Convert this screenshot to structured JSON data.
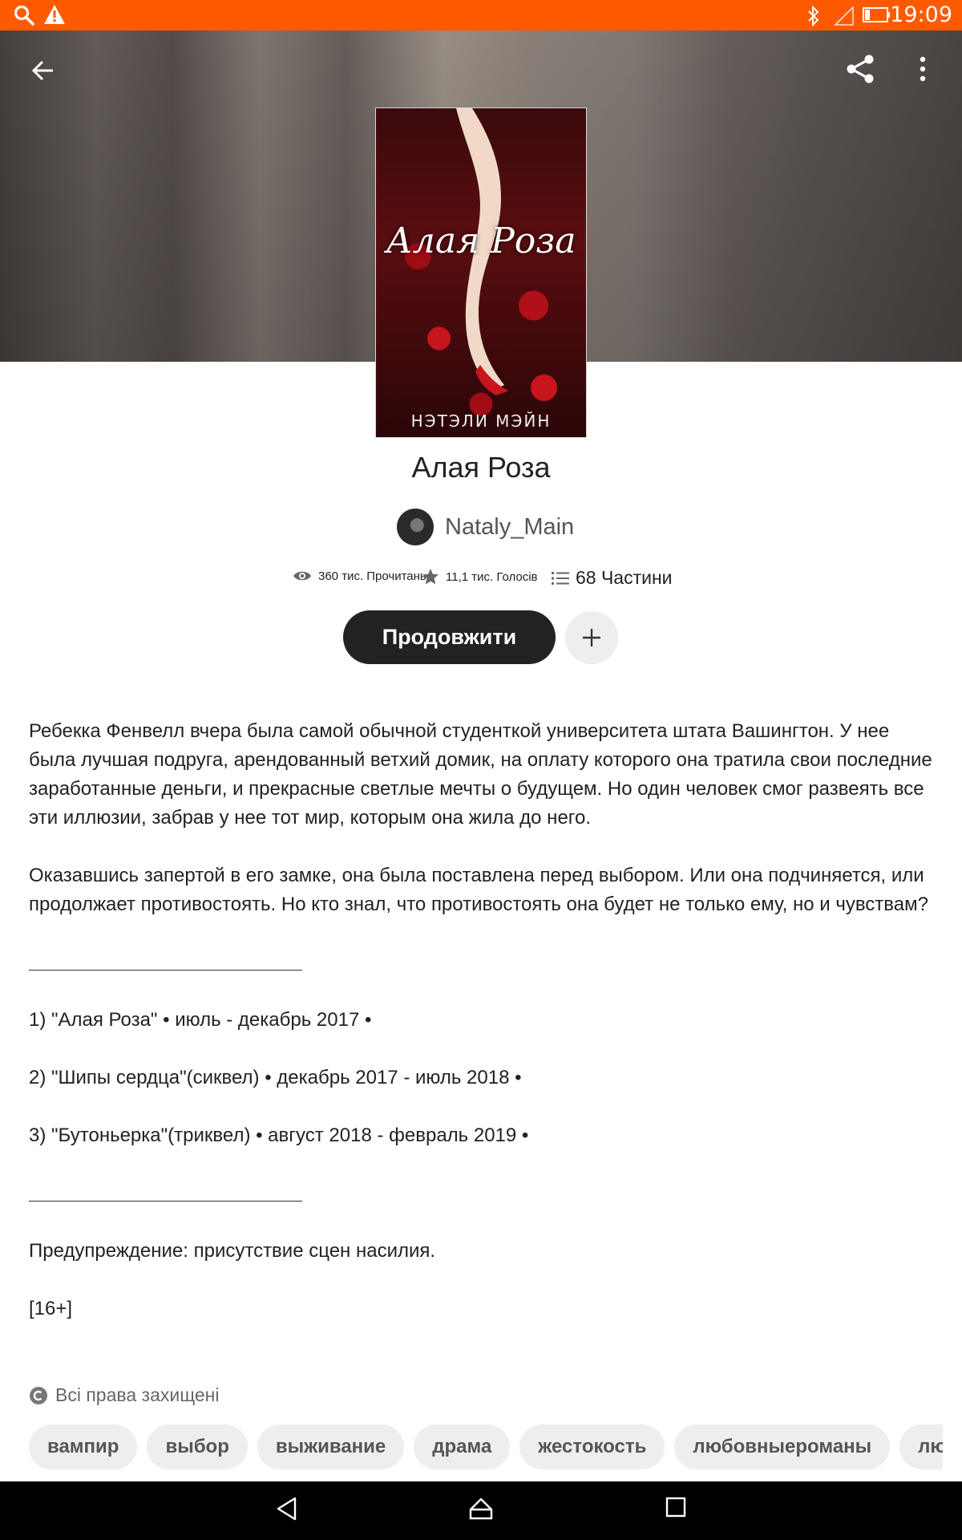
{
  "status_bar": {
    "time": "19:09",
    "left_icons": [
      "search-icon",
      "warning-icon"
    ],
    "right_icons": [
      "bluetooth-icon",
      "signal-icon",
      "battery-icon"
    ]
  },
  "header": {
    "back_icon": "arrow-back-icon",
    "share_icon": "share-icon",
    "menu_icon": "more-vertical-icon"
  },
  "book": {
    "cover_title": "Алая Роза",
    "cover_author": "НЭТЭЛИ МЭЙН",
    "title": "Алая Роза",
    "author": "Nataly_Main",
    "stats": {
      "reads": "360 тис. Прочитань",
      "votes": "11,1 тис. Голосів",
      "parts": "68 Частини"
    },
    "continue_label": "Продовжити"
  },
  "description": {
    "paragraph1": "Ребекка Фенвелл вчера была самой обычной студенткой университета штата Вашингтон. У нее была лучшая подруга, арендованный ветхий домик, на оплату которого она тратила свои последние заработанные деньги, и прекрасные светлые мечты о будущем. Но один человек смог развеять все эти иллюзии, забрав у нее тот мир, которым она жила до него.",
    "paragraph2": "Оказавшись запертой в его замке, она была поставлена перед выбором. Или она подчиняется, или продолжает противостоять. Но кто знал, что противостоять она будет не только ему, но и чувствам?",
    "series": [
      "1) \"Алая Роза\" • июль - декабрь 2017 •",
      "2) \"Шипы сердца\"(сиквел) • декабрь 2017 - июль 2018 •",
      "3) \"Бутоньерка\"(триквел) • август 2018 - февраль 2019 •"
    ],
    "warning": "Предупреждение: присутствие сцен насилия.",
    "age": "[16+]"
  },
  "rights": "Всі права захищені",
  "tags": [
    "вампир",
    "выбор",
    "выживание",
    "драма",
    "жестокость",
    "любовныероманы",
    "любовь"
  ],
  "nav": {
    "back_icon": "nav-back-icon",
    "home_icon": "nav-home-icon",
    "recents_icon": "nav-recents-icon"
  },
  "colors": {
    "status_bar": "#ff5a00",
    "button_dark": "#222222",
    "tag_bg": "#eeeeee"
  }
}
